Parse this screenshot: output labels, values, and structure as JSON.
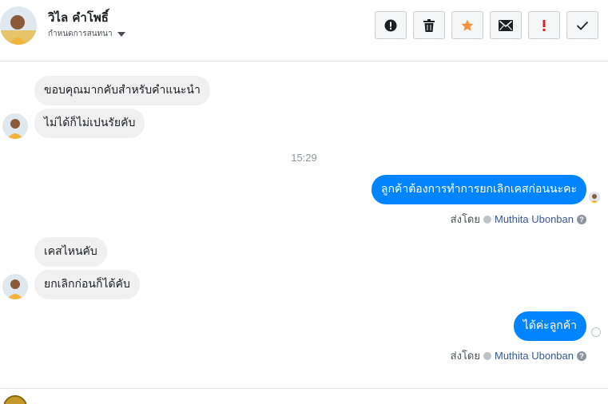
{
  "contact": {
    "name": "วิไล คำโพธิ์",
    "subtitle": "กำหนดการสนทนา"
  },
  "toolbar": {
    "buttons": [
      {
        "icon": "alert-circle-icon",
        "label": "spam"
      },
      {
        "icon": "trash-icon",
        "label": "delete"
      },
      {
        "icon": "star-icon",
        "label": "star"
      },
      {
        "icon": "envelope-icon",
        "label": "mark-unread"
      },
      {
        "icon": "exclamation-icon",
        "label": "important"
      },
      {
        "icon": "check-icon",
        "label": "done"
      }
    ]
  },
  "messages": {
    "in1": "ขอบคุณมากคับสำหรับคำแนะนำ",
    "in2": "ไม่ได้ก็ไม่เปนรัยคับ",
    "timestamp": "15:29",
    "out1": "ลูกค้าต้องการทำการยกเลิกเคสก่อนนะคะ",
    "in3": "เคสไหนคับ",
    "in4": "ยกเลิกก่อนก็ได้คับ",
    "out2": "ได้ค่ะลูกค้า"
  },
  "sent_by": {
    "label": "ส่งโดย",
    "agent": "Muthita Ubonban",
    "help": "?"
  },
  "composer": {
    "text": "..."
  },
  "colors": {
    "outgoing_bubble": "#0084ff",
    "incoming_bubble": "#f1f0f0",
    "star": "#f7923b",
    "important": "#e02020",
    "link": "#385898"
  }
}
